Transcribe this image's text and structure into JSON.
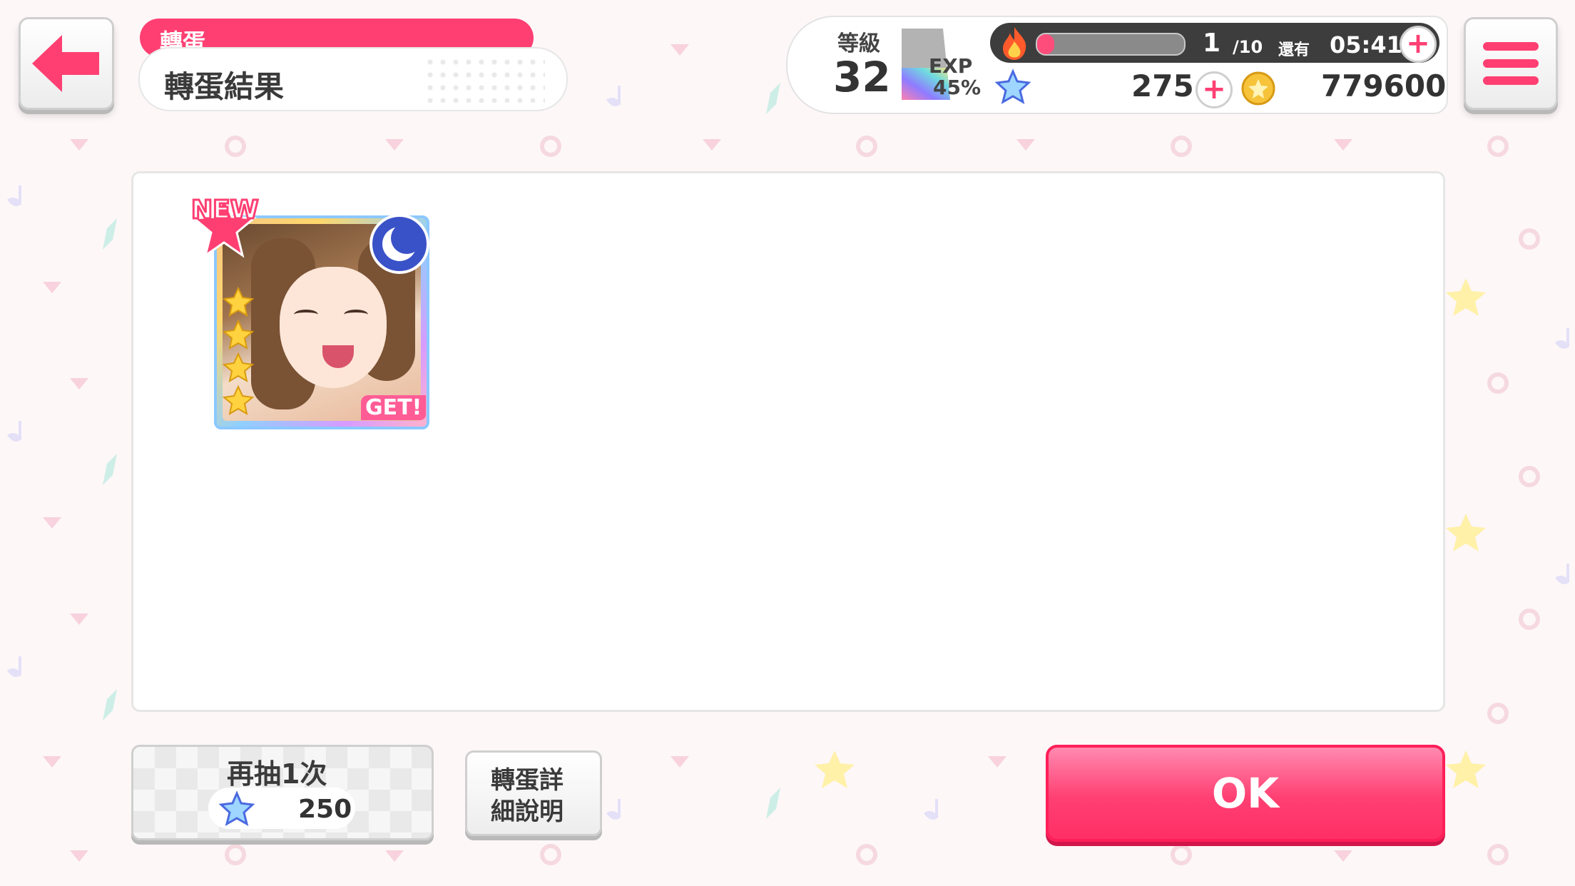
{
  "header": {
    "tab_label": "轉蛋",
    "title": "轉蛋結果"
  },
  "status": {
    "level_label": "等級",
    "level": "32",
    "exp_label": "EXP",
    "exp_percent": "45%",
    "exp_progress": 0.45,
    "stamina_current": "1",
    "stamina_max": "/10",
    "stamina_progress": 0.1,
    "remaining_label": "還有",
    "timer": "05:41",
    "stars": "275",
    "coins": "779600"
  },
  "result": {
    "card": {
      "badge_new": "NEW",
      "badge_get": "GET!",
      "rarity_stars": 4,
      "attribute_icon": "moon-icon"
    }
  },
  "buttons": {
    "draw_again_label": "再抽1次",
    "draw_cost": "250",
    "detail_line1": "轉蛋詳",
    "detail_line2": "細說明",
    "ok_label": "OK"
  },
  "icons": {
    "back": "arrow-left-icon",
    "menu": "hamburger-menu-icon",
    "stamina": "flame-icon",
    "star_currency": "star-icon",
    "coin": "coin-icon"
  },
  "colors": {
    "accent": "#ff3f72",
    "background": "#fdf7f8"
  }
}
